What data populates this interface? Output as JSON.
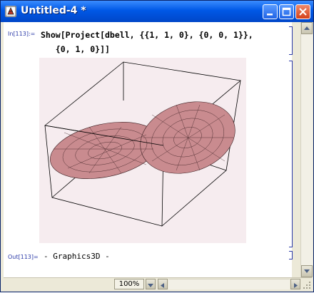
{
  "window": {
    "title": "Untitled-4 *"
  },
  "cell_input": {
    "label": "In[113]:=",
    "code_line1": "Show[Project[dbell, {{1, 1, 0}, {0, 0, 1}},",
    "code_line2": "   {0, 1, 0}]]"
  },
  "cell_output": {
    "label": "Out[113]=",
    "value": "- Graphics3D -"
  },
  "statusbar": {
    "zoom": "100%"
  },
  "icons": {
    "app": "mathematica-notebook-icon",
    "minimize": "minimize-icon",
    "maximize": "maximize-icon",
    "close": "close-icon"
  },
  "colors": {
    "titlebar": "#0058e6",
    "surface_fill": "#c98b8f",
    "graphic_bg": "#f6ecef",
    "label_blue": "#2b3aa8"
  }
}
